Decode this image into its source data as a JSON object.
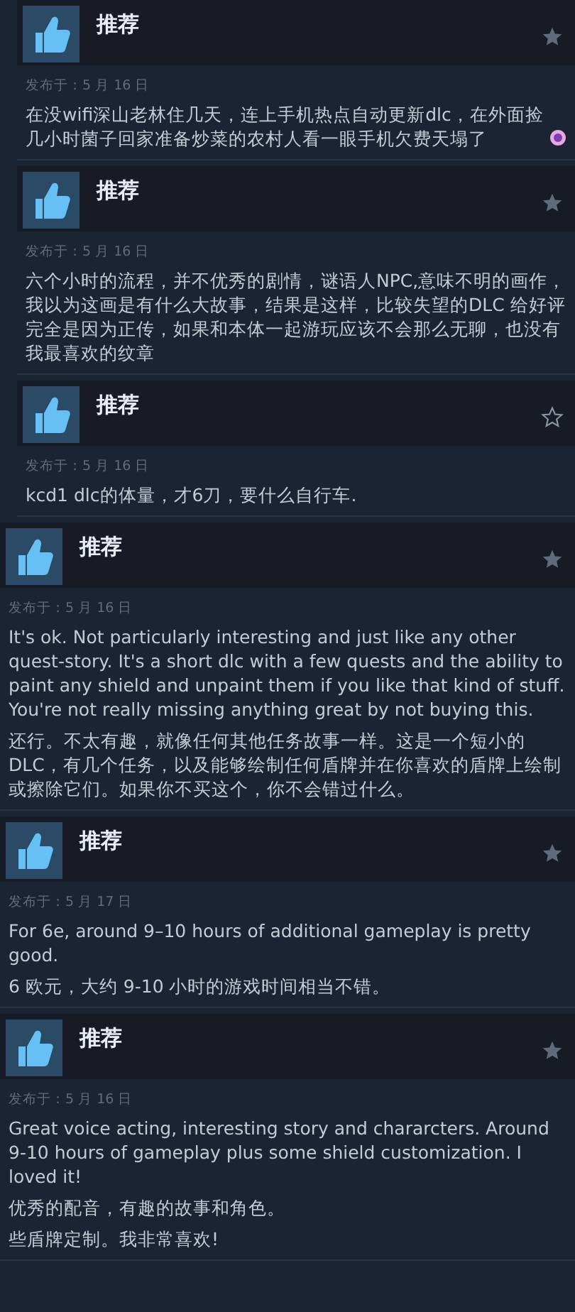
{
  "reviews": [
    {
      "verdict": "推荐",
      "starred": true,
      "date": "发布于：5 月 16 日",
      "paragraphs": [
        "在没wifi深山老林住几天，连上手机热点自动更新dlc，在外面捡几小时菌子回家准备炒菜的农村人看一眼手机欠费天塌了"
      ],
      "emoji": true
    },
    {
      "verdict": "推荐",
      "starred": true,
      "date": "发布于：5 月 16 日",
      "paragraphs": [
        "六个小时的流程，并不优秀的剧情，谜语人NPC,意味不明的画作，我以为这画是有什么大故事，结果是这样，比较失望的DLC 给好评完全是因为正传，如果和本体一起游玩应该不会那么无聊，也没有我最喜欢的纹章"
      ]
    },
    {
      "verdict": "推荐",
      "starred": false,
      "date": "发布于：5 月 16 日",
      "paragraphs": [
        "kcd1 dlc的体量，才6刀，要什么自行车."
      ]
    },
    {
      "verdict": "推荐",
      "starred": true,
      "date": "发布于：5 月 16 日",
      "paragraphs": [
        "It's ok. Not particularly interesting and just like any other quest-story. It's a short dlc with a few quests and the ability to paint any shield and unpaint them if you like that kind of stuff. You're not really missing anything great by not buying this.",
        "还行。不太有趣，就像任何其他任务故事一样。这是一个短小的DLC，有几个任务，以及能够绘制任何盾牌并在你喜欢的盾牌上绘制或擦除它们。如果你不买这个，你不会错过什么。"
      ]
    },
    {
      "verdict": "推荐",
      "starred": true,
      "date": "发布于：5 月 17 日",
      "paragraphs": [
        "For 6e, around 9–10 hours of additional gameplay is pretty good.",
        "6 欧元，大约 9-10 小时的游戏时间相当不错。"
      ]
    },
    {
      "verdict": "推荐",
      "starred": true,
      "date": "发布于：5 月 16 日",
      "paragraphs": [
        "Great voice acting, interesting story and chararcters. Around 9-10 hours of gameplay plus some shield customization. I loved it!",
        "优秀的配音，有趣的故事和角色。",
        "些盾牌定制。我非常喜欢!"
      ]
    }
  ]
}
